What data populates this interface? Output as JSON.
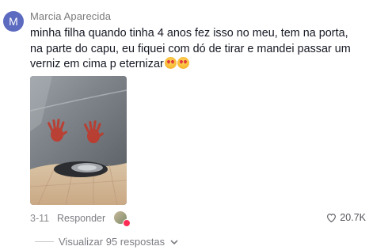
{
  "comment": {
    "avatar_letter": "M",
    "avatar_color": "#5c6bc0",
    "username": "Marcia Aparecida",
    "text": "minha filha quando tinha 4 anos fez isso no meu, tem na porta, na parte do capu, eu fiquei com dó de tirar e mandei passar um verniz em cima p eternizar",
    "emojis": [
      "heart-eyes-emoji",
      "heart-eyes-emoji"
    ],
    "date": "3-11",
    "reply_label": "Responder",
    "like_count": "20.7K",
    "view_replies_label": "Visualizar 95 respostas"
  },
  "colors": {
    "text": "#161823",
    "muted": "#8a8b91",
    "accent": "#fe2c55"
  }
}
